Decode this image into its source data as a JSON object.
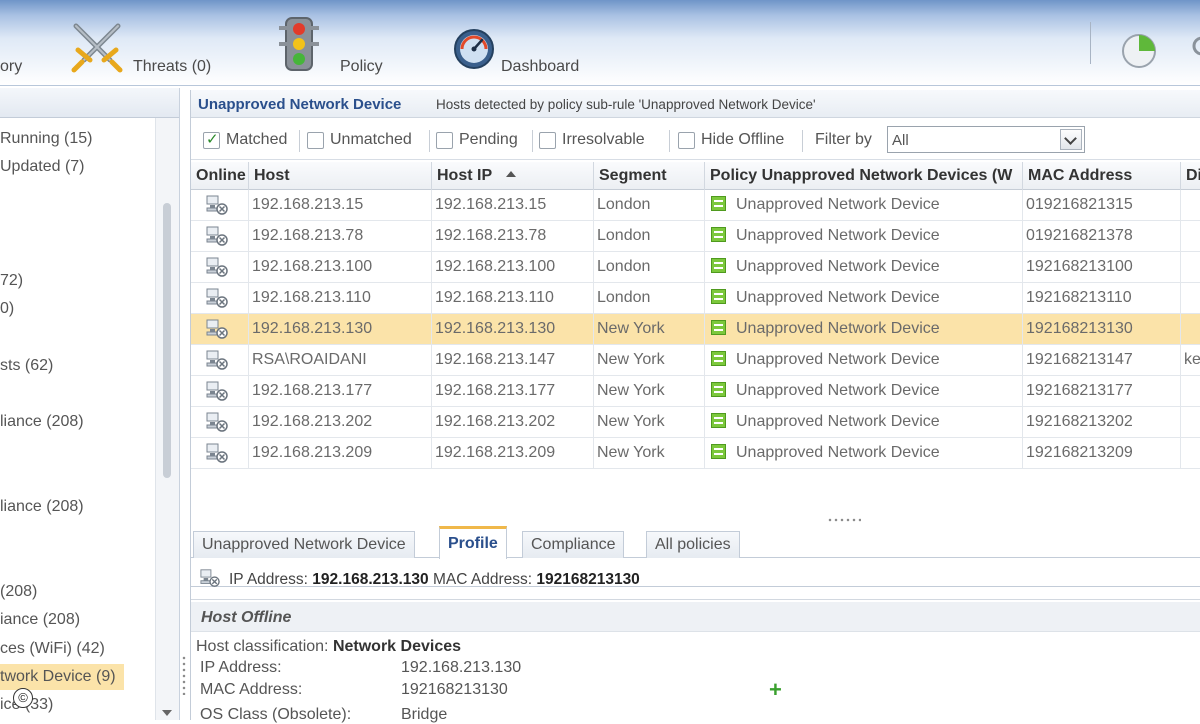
{
  "toolbar": {
    "items": [
      {
        "label": "ory",
        "icon": "history-icon"
      },
      {
        "label": "Threats (0)",
        "icon": "crossed-swords-icon"
      },
      {
        "label": "Policy",
        "icon": "traffic-light-icon"
      },
      {
        "label": "Dashboard",
        "icon": "gauge-icon"
      }
    ],
    "right_icons": [
      "pie-chart-icon",
      "partial-icon"
    ]
  },
  "sidebar": {
    "items": [
      {
        "label": "Running (15)"
      },
      {
        "label": "Updated (7)"
      },
      {
        "label": "72)"
      },
      {
        "label": "0)"
      },
      {
        "label": "sts (62)"
      },
      {
        "label": "liance (208)"
      },
      {
        "label": "liance (208)"
      },
      {
        "label": "(208)"
      },
      {
        "label": "iance (208)"
      },
      {
        "label": "ces (WiFi) (42)"
      },
      {
        "label": "twork Device (9)",
        "selected": true
      },
      {
        "label": "ice (33)"
      }
    ],
    "copyright_badge": "©"
  },
  "header": {
    "title": "Unapproved Network Device",
    "description": "Hosts detected by policy sub-rule 'Unapproved Network Device'"
  },
  "filters": {
    "matched": {
      "label": "Matched",
      "checked": true
    },
    "unmatched": {
      "label": "Unmatched",
      "checked": false
    },
    "pending": {
      "label": "Pending",
      "checked": false
    },
    "irresolvable": {
      "label": "Irresolvable",
      "checked": false
    },
    "hide_offline": {
      "label": "Hide Offline",
      "checked": false
    },
    "filter_by_label": "Filter by",
    "filter_by_value": "All"
  },
  "table": {
    "columns": [
      "Online",
      "Host",
      "Host IP",
      "Segment",
      "Policy Unapproved Network Devices (W",
      "MAC Address",
      "Di"
    ],
    "sorted_column": "Host IP",
    "rows": [
      {
        "host": "192.168.213.15",
        "ip": "192.168.213.15",
        "segment": "London",
        "policy": "Unapproved Network Device",
        "mac": "019216821315",
        "extra": ""
      },
      {
        "host": "192.168.213.78",
        "ip": "192.168.213.78",
        "segment": "London",
        "policy": "Unapproved Network Device",
        "mac": "019216821378",
        "extra": ""
      },
      {
        "host": "192.168.213.100",
        "ip": "192.168.213.100",
        "segment": "London",
        "policy": "Unapproved Network Device",
        "mac": "192168213100",
        "extra": ""
      },
      {
        "host": "192.168.213.110",
        "ip": "192.168.213.110",
        "segment": "London",
        "policy": "Unapproved Network Device",
        "mac": "192168213110",
        "extra": ""
      },
      {
        "host": "192.168.213.130",
        "ip": "192.168.213.130",
        "segment": "New York",
        "policy": "Unapproved Network Device",
        "mac": "192168213130",
        "extra": "",
        "selected": true
      },
      {
        "host": "RSA\\ROAIDANI",
        "ip": "192.168.213.147",
        "segment": "New York",
        "policy": "Unapproved Network Device",
        "mac": "192168213147",
        "extra": "ke"
      },
      {
        "host": "192.168.213.177",
        "ip": "192.168.213.177",
        "segment": "New York",
        "policy": "Unapproved Network Device",
        "mac": "192168213177",
        "extra": ""
      },
      {
        "host": "192.168.213.202",
        "ip": "192.168.213.202",
        "segment": "New York",
        "policy": "Unapproved Network Device",
        "mac": "192168213202",
        "extra": ""
      },
      {
        "host": "192.168.213.209",
        "ip": "192.168.213.209",
        "segment": "New York",
        "policy": "Unapproved Network Device",
        "mac": "192168213209",
        "extra": ""
      }
    ]
  },
  "tabs": [
    {
      "label": "Unapproved Network Device"
    },
    {
      "label": "Profile",
      "active": true
    },
    {
      "label": "Compliance"
    },
    {
      "label": "All policies"
    }
  ],
  "info": {
    "ip_label": "IP Address:",
    "ip_value": "192.168.213.130",
    "mac_label": "MAC Address:",
    "mac_value": "192168213130"
  },
  "detail": {
    "heading": "Host Offline",
    "classification_label": "Host classification:",
    "classification_value": "Network Devices",
    "ip_label": "IP Address:",
    "ip_value": "192.168.213.130",
    "mac_label": "MAC Address:",
    "mac_value": "192168213130",
    "os_label": "OS Class (Obsolete):",
    "os_value": "Bridge"
  }
}
